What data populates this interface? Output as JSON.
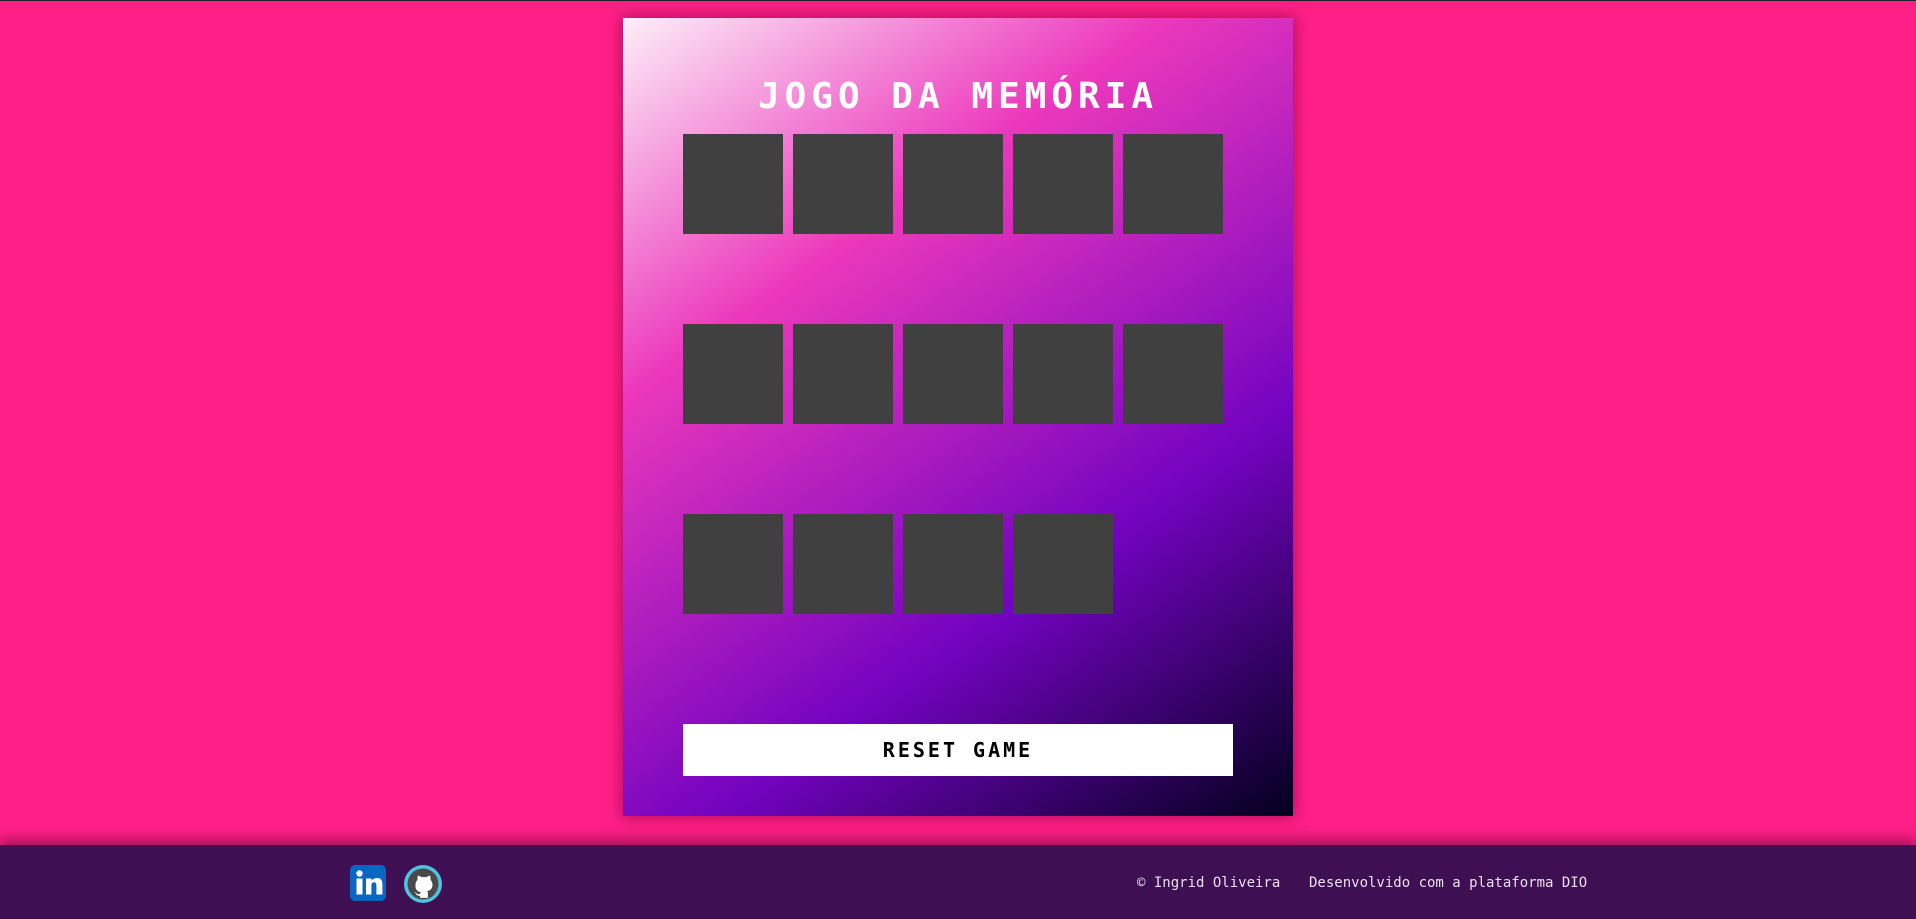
{
  "colors": {
    "page_background": "#ff1f87",
    "card_back": "#404040",
    "footer_background": "#3e0f52",
    "panel_gradient": [
      "#fdeff9",
      "#ec38bc",
      "#7303c0",
      "#03001e"
    ],
    "linkedin_blue": "#0a66c2",
    "github_ring": "#4fc3e0"
  },
  "game": {
    "title": "JOGO DA MEMÓRIA",
    "card_count": 14,
    "cards_face_down": 14,
    "reset_label": "RESET GAME"
  },
  "footer": {
    "social_icons": [
      "linkedin-icon",
      "github-icon"
    ],
    "credit": "© Ingrid Oliveira",
    "platform_text": "Desenvolvido com a plataforma DIO"
  }
}
